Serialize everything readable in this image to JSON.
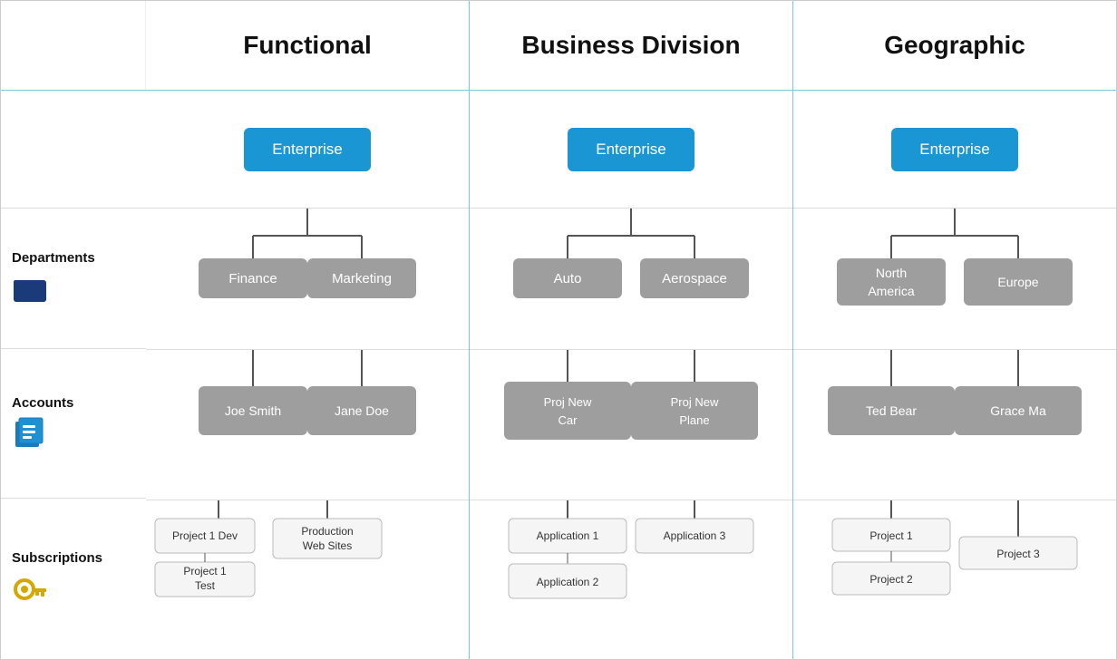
{
  "headers": {
    "functional": "Functional",
    "business": "Business Division",
    "geographic": "Geographic"
  },
  "sidebar": {
    "departments_label": "Departments",
    "accounts_label": "Accounts",
    "subscriptions_label": "Subscriptions"
  },
  "functional": {
    "enterprise": "Enterprise",
    "dept1": "Finance",
    "dept2": "Marketing",
    "acct1": "Joe Smith",
    "acct2": "Jane Doe",
    "sub1a": "Project 1 Dev",
    "sub1b": "Project 1 Test",
    "sub2": "Production Web Sites"
  },
  "business": {
    "enterprise": "Enterprise",
    "dept1": "Auto",
    "dept2": "Aerospace",
    "acct1": "Proj New Car",
    "acct2": "Proj New Plane",
    "sub1a": "Application 1",
    "sub1b": "Application 2",
    "sub2": "Application 3"
  },
  "geographic": {
    "enterprise": "Enterprise",
    "dept1": "North America",
    "dept2": "Europe",
    "acct1": "Ted Bear",
    "acct2": "Grace Ma",
    "sub1a": "Project 1",
    "sub1b": "Project 2",
    "sub2": "Project 3"
  }
}
